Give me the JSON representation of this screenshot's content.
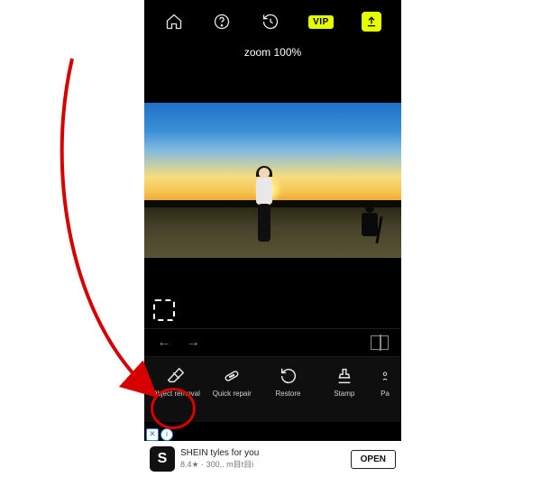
{
  "topbar": {
    "vip_label": "VIP"
  },
  "zoom_label": "zoom 100%",
  "history": {},
  "tools": [
    {
      "id": "object-removal",
      "label": "Object removal"
    },
    {
      "id": "quick-repair",
      "label": "Quick repair"
    },
    {
      "id": "restore",
      "label": "Restore"
    },
    {
      "id": "stamp",
      "label": "Stamp"
    },
    {
      "id": "pa",
      "label": "Pa"
    }
  ],
  "ad": {
    "logo_text": "S",
    "line1": "SHEIN tyles for you",
    "line2": "8.4★ · 300.. m目t目i",
    "cta": "OPEN"
  }
}
